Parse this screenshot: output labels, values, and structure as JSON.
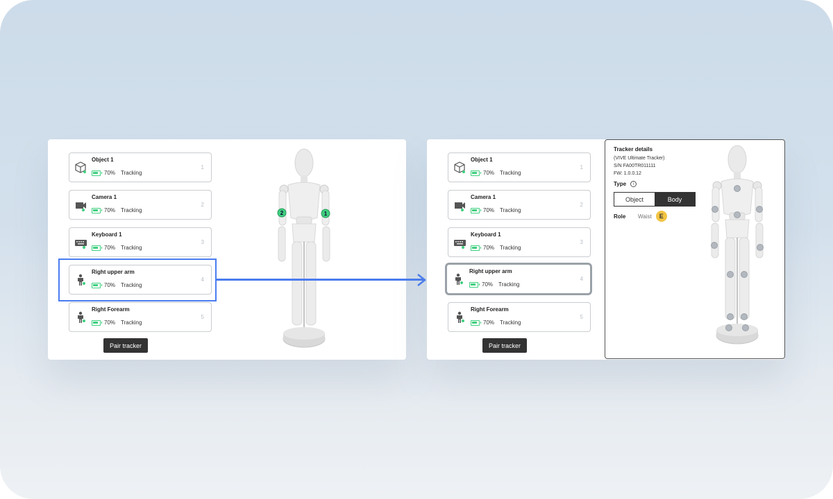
{
  "colors": {
    "accent_blue": "#4a7cf0",
    "battery_green": "#3fcf7f",
    "tracker_badge_green": "#3fcf7f",
    "role_badge_yellow": "#f2c443",
    "dark_button": "#333333",
    "selected_border": "#9aa1a8"
  },
  "left_panel": {
    "trackers": [
      {
        "name": "Object 1",
        "icon": "cube-icon",
        "battery": "70%",
        "status": "Tracking",
        "index": "1"
      },
      {
        "name": "Camera 1",
        "icon": "camera-icon",
        "battery": "70%",
        "status": "Tracking",
        "index": "2"
      },
      {
        "name": "Keyboard 1",
        "icon": "keyboard-icon",
        "battery": "70%",
        "status": "Tracking",
        "index": "3"
      },
      {
        "name": "Right upper arm",
        "icon": "body-icon",
        "battery": "70%",
        "status": "Tracking",
        "index": "4"
      },
      {
        "name": "Right Forearm",
        "icon": "body-icon",
        "battery": "70%",
        "status": "Tracking",
        "index": "5"
      }
    ],
    "pair_button": "Pair tracker",
    "mannequin_markers": [
      "2",
      "1"
    ],
    "highlighted_index": 3
  },
  "right_panel": {
    "trackers": [
      {
        "name": "Object 1",
        "icon": "cube-icon",
        "battery": "70%",
        "status": "Tracking",
        "index": "1"
      },
      {
        "name": "Camera 1",
        "icon": "camera-icon",
        "battery": "70%",
        "status": "Tracking",
        "index": "2"
      },
      {
        "name": "Keyboard 1",
        "icon": "keyboard-icon",
        "battery": "70%",
        "status": "Tracking",
        "index": "3"
      },
      {
        "name": "Right upper arm",
        "icon": "body-icon",
        "battery": "70%",
        "status": "Tracking",
        "index": "4"
      },
      {
        "name": "Right Forearm",
        "icon": "body-icon",
        "battery": "70%",
        "status": "Tracking",
        "index": "5"
      }
    ],
    "pair_button": "Pair tracker",
    "selected_index": 3,
    "details": {
      "title": "Tracker details",
      "model": "(VIVE Ultimate Tracker)",
      "serial": "S/N FA00TR011111",
      "firmware": "FW: 1.0.0.12",
      "type_label": "Type",
      "info_glyph": "i",
      "type_options": [
        "Object",
        "Body"
      ],
      "type_selected": "Body",
      "role_label": "Role",
      "role_value": "Waist",
      "role_badge": "E"
    }
  }
}
